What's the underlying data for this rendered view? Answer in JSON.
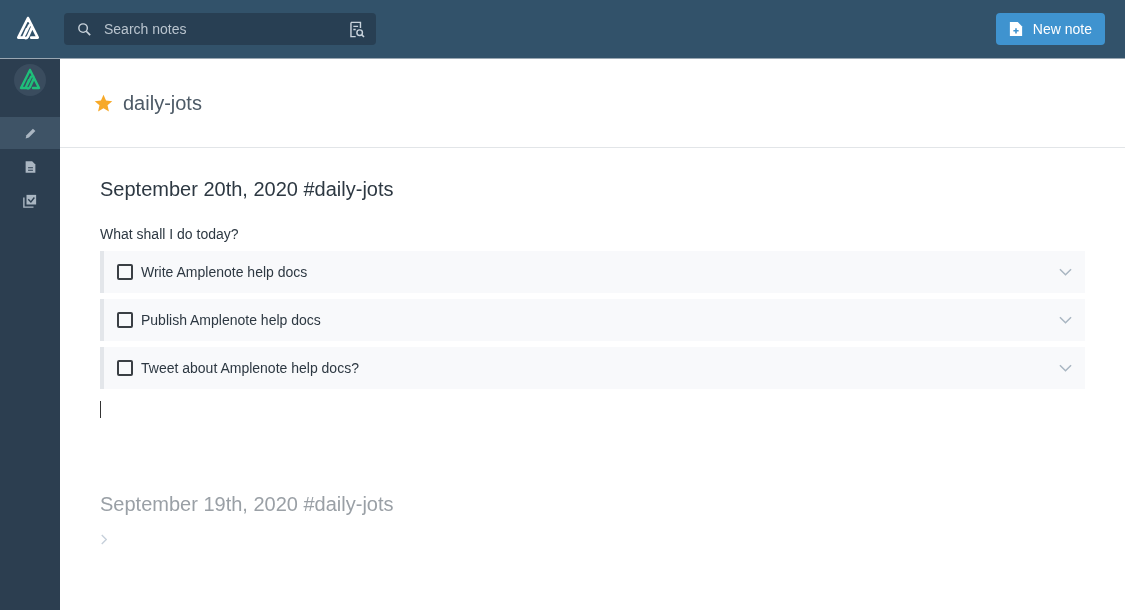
{
  "search": {
    "placeholder": "Search notes"
  },
  "new_note_button": "New note",
  "sidebar": {
    "items": [
      {
        "kind": "pencil",
        "selected": true
      },
      {
        "kind": "document",
        "selected": false
      },
      {
        "kind": "tasks",
        "selected": false
      }
    ]
  },
  "note": {
    "title": "daily-jots",
    "starred": true
  },
  "entries": [
    {
      "heading": "September 20th, 2020 #daily-jots",
      "expanded": true,
      "text": "What shall I do today?",
      "tasks": [
        {
          "label": "Write Amplenote help docs",
          "checked": false
        },
        {
          "label": "Publish Amplenote help docs",
          "checked": false
        },
        {
          "label": "Tweet about Amplenote help docs?",
          "checked": false
        }
      ]
    },
    {
      "heading": "September 19th, 2020 #daily-jots",
      "expanded": false
    }
  ]
}
